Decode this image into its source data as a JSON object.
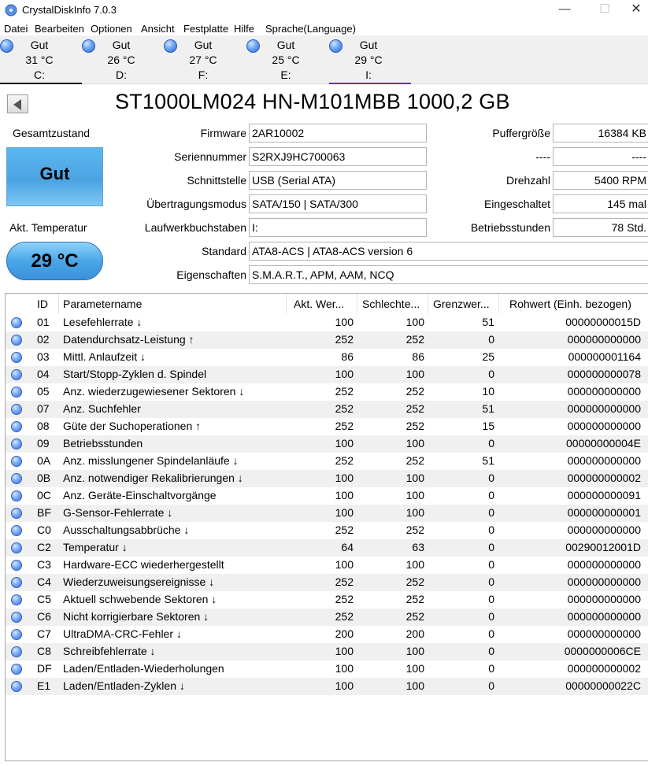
{
  "window": {
    "title": "CrystalDiskInfo 7.0.3",
    "min": "—",
    "max": "☐",
    "close": "✕"
  },
  "menu": [
    "Datei",
    "Bearbeiten",
    "Optionen",
    "Ansicht",
    "Festplatte",
    "Hilfe",
    "Sprache(Language)"
  ],
  "drives": [
    {
      "status": "Gut",
      "temp": "31 °C",
      "letter": "C:"
    },
    {
      "status": "Gut",
      "temp": "26 °C",
      "letter": "D:"
    },
    {
      "status": "Gut",
      "temp": "27 °C",
      "letter": "F:"
    },
    {
      "status": "Gut",
      "temp": "25 °C",
      "letter": "E:"
    },
    {
      "status": "Gut",
      "temp": "29 °C",
      "letter": "I:"
    }
  ],
  "model": "ST1000LM024 HN-M101MBB 1000,2 GB",
  "health": {
    "label": "Gesamtzustand",
    "value": "Gut"
  },
  "temperature": {
    "label": "Akt. Temperatur",
    "value": "29 °C"
  },
  "info": {
    "firmware": {
      "label": "Firmware",
      "value": "2AR10002"
    },
    "serial": {
      "label": "Seriennummer",
      "value": "S2RXJ9HC700063"
    },
    "interface": {
      "label": "Schnittstelle",
      "value": "USB (Serial ATA)"
    },
    "transfer": {
      "label": "Übertragungsmodus",
      "value": "SATA/150 | SATA/300"
    },
    "letters": {
      "label": "Laufwerkbuchstaben",
      "value": "I:"
    },
    "standard": {
      "label": "Standard",
      "value": "ATA8-ACS | ATA8-ACS version 6"
    },
    "features": {
      "label": "Eigenschaften",
      "value": "S.M.A.R.T., APM, AAM, NCQ"
    },
    "buffer": {
      "label": "Puffergröße",
      "value": "16384 KB"
    },
    "blank": {
      "label": "----",
      "value": "----"
    },
    "rpm": {
      "label": "Drehzahl",
      "value": "5400 RPM"
    },
    "power_count": {
      "label": "Eingeschaltet",
      "value": "145 mal"
    },
    "power_hours": {
      "label": "Betriebsstunden",
      "value": "78 Std."
    }
  },
  "table": {
    "headers": {
      "id": "ID",
      "name": "Parametername",
      "cur": "Akt. Wer...",
      "worst": "Schlechte...",
      "thr": "Grenzwer...",
      "raw": "Rohwert (Einh. bezogen)"
    },
    "rows": [
      {
        "id": "01",
        "name": "Lesefehlerrate ↓",
        "cur": "100",
        "worst": "100",
        "thr": "51",
        "raw": "00000000015D"
      },
      {
        "id": "02",
        "name": "Datendurchsatz-Leistung ↑",
        "cur": "252",
        "worst": "252",
        "thr": "0",
        "raw": "000000000000"
      },
      {
        "id": "03",
        "name": "Mittl. Anlaufzeit ↓",
        "cur": "86",
        "worst": "86",
        "thr": "25",
        "raw": "000000001164"
      },
      {
        "id": "04",
        "name": "Start/Stopp-Zyklen d. Spindel",
        "cur": "100",
        "worst": "100",
        "thr": "0",
        "raw": "000000000078"
      },
      {
        "id": "05",
        "name": "Anz. wiederzugewiesener Sektoren ↓",
        "cur": "252",
        "worst": "252",
        "thr": "10",
        "raw": "000000000000"
      },
      {
        "id": "07",
        "name": "Anz. Suchfehler",
        "cur": "252",
        "worst": "252",
        "thr": "51",
        "raw": "000000000000"
      },
      {
        "id": "08",
        "name": "Güte der Suchoperationen ↑",
        "cur": "252",
        "worst": "252",
        "thr": "15",
        "raw": "000000000000"
      },
      {
        "id": "09",
        "name": "Betriebsstunden",
        "cur": "100",
        "worst": "100",
        "thr": "0",
        "raw": "00000000004E"
      },
      {
        "id": "0A",
        "name": "Anz. misslungener Spindelanläufe ↓",
        "cur": "252",
        "worst": "252",
        "thr": "51",
        "raw": "000000000000"
      },
      {
        "id": "0B",
        "name": "Anz. notwendiger Rekalibrierungen ↓",
        "cur": "100",
        "worst": "100",
        "thr": "0",
        "raw": "000000000002"
      },
      {
        "id": "0C",
        "name": "Anz. Geräte-Einschaltvorgänge",
        "cur": "100",
        "worst": "100",
        "thr": "0",
        "raw": "000000000091"
      },
      {
        "id": "BF",
        "name": "G-Sensor-Fehlerrate ↓",
        "cur": "100",
        "worst": "100",
        "thr": "0",
        "raw": "000000000001"
      },
      {
        "id": "C0",
        "name": "Ausschaltungsabbrüche ↓",
        "cur": "252",
        "worst": "252",
        "thr": "0",
        "raw": "000000000000"
      },
      {
        "id": "C2",
        "name": "Temperatur ↓",
        "cur": "64",
        "worst": "63",
        "thr": "0",
        "raw": "00290012001D"
      },
      {
        "id": "C3",
        "name": "Hardware-ECC wiederhergestellt",
        "cur": "100",
        "worst": "100",
        "thr": "0",
        "raw": "000000000000"
      },
      {
        "id": "C4",
        "name": "Wiederzuweisungsereignisse ↓",
        "cur": "252",
        "worst": "252",
        "thr": "0",
        "raw": "000000000000"
      },
      {
        "id": "C5",
        "name": "Aktuell schwebende Sektoren ↓",
        "cur": "252",
        "worst": "252",
        "thr": "0",
        "raw": "000000000000"
      },
      {
        "id": "C6",
        "name": "Nicht korrigierbare Sektoren ↓",
        "cur": "252",
        "worst": "252",
        "thr": "0",
        "raw": "000000000000"
      },
      {
        "id": "C7",
        "name": "UltraDMA-CRC-Fehler ↓",
        "cur": "200",
        "worst": "200",
        "thr": "0",
        "raw": "000000000000"
      },
      {
        "id": "C8",
        "name": "Schreibfehlerrate ↓",
        "cur": "100",
        "worst": "100",
        "thr": "0",
        "raw": "0000000006CE"
      },
      {
        "id": "DF",
        "name": "Laden/Entladen-Wiederholungen",
        "cur": "100",
        "worst": "100",
        "thr": "0",
        "raw": "000000000002"
      },
      {
        "id": "E1",
        "name": "Laden/Entladen-Zyklen ↓",
        "cur": "100",
        "worst": "100",
        "thr": "0",
        "raw": "00000000022C"
      }
    ]
  },
  "colors": {
    "status_good": "#4aa6e8",
    "selected_tab": "#6b2fa0",
    "active_tab": "#000000"
  }
}
